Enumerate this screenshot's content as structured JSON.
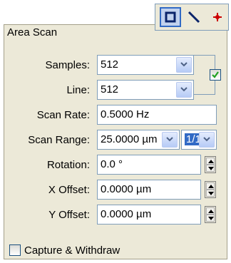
{
  "toolbar": {
    "tools": [
      {
        "name": "rectangle-tool",
        "icon": "square-icon",
        "active": true
      },
      {
        "name": "line-tool",
        "icon": "diagonal-line-icon",
        "active": false
      },
      {
        "name": "point-tool",
        "icon": "crosshair-icon",
        "active": false
      }
    ]
  },
  "panel": {
    "title": "Area Scan",
    "samples": {
      "label": "Samples:",
      "value": "512"
    },
    "line": {
      "label": "Line:",
      "value": "512"
    },
    "link_checked": true,
    "scan_rate": {
      "label": "Scan Rate:",
      "value": "0.5000 Hz"
    },
    "scan_range": {
      "label": "Scan Range:",
      "value": "25.0000 µm",
      "ratio": "1/1"
    },
    "rotation": {
      "label": "Rotation:",
      "value": "0.0 °"
    },
    "x_offset": {
      "label": "X Offset:",
      "value": "0.0000 µm"
    },
    "y_offset": {
      "label": "Y Offset:",
      "value": "0.0000 µm"
    },
    "capture": {
      "label": "Capture & Withdraw",
      "checked": false
    }
  },
  "colors": {
    "active_tool_border": "#316ac5",
    "line_tool": "#0a246a",
    "point_tool": "#cc0000",
    "check": "#21a121"
  }
}
